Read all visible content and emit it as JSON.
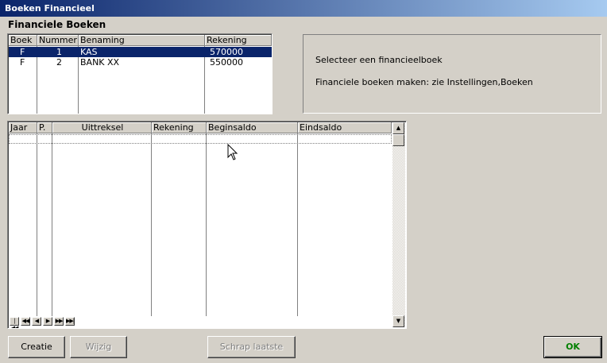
{
  "window": {
    "title": "Boeken Financieel"
  },
  "section_title": "Financiele Boeken",
  "books_table": {
    "columns": [
      "Boek",
      "Nummer",
      "Benaming",
      "Rekening"
    ],
    "rows": [
      {
        "boek": "F",
        "nummer": "1",
        "benaming": "KAS",
        "rekening": "570000",
        "selected": true
      },
      {
        "boek": "F",
        "nummer": "2",
        "benaming": "BANK XX",
        "rekening": "550000",
        "selected": false
      }
    ]
  },
  "info": {
    "line1": "Selecteer een financieelboek",
    "line2": "Financiele boeken maken: zie Instellingen,Boeken"
  },
  "statements_table": {
    "columns": [
      "Jaar",
      "P.",
      "Uittreksel",
      "Rekening",
      "Beginsaldo",
      "Eindsaldo"
    ]
  },
  "navigator": {
    "first": "|◀◀",
    "prev_page": "◀◀",
    "prev": "◀",
    "next": "▶",
    "next_page": "▶▶",
    "last": "▶▶|"
  },
  "buttons": {
    "creatie": "Creatie",
    "wijzig": "Wijzig",
    "schrap": "Schrap laatste",
    "ok": "OK"
  },
  "colors": {
    "titlebar_start": "#0a246a",
    "titlebar_end": "#a6caf0",
    "selection": "#0a246a",
    "ok_text": "#008000"
  }
}
